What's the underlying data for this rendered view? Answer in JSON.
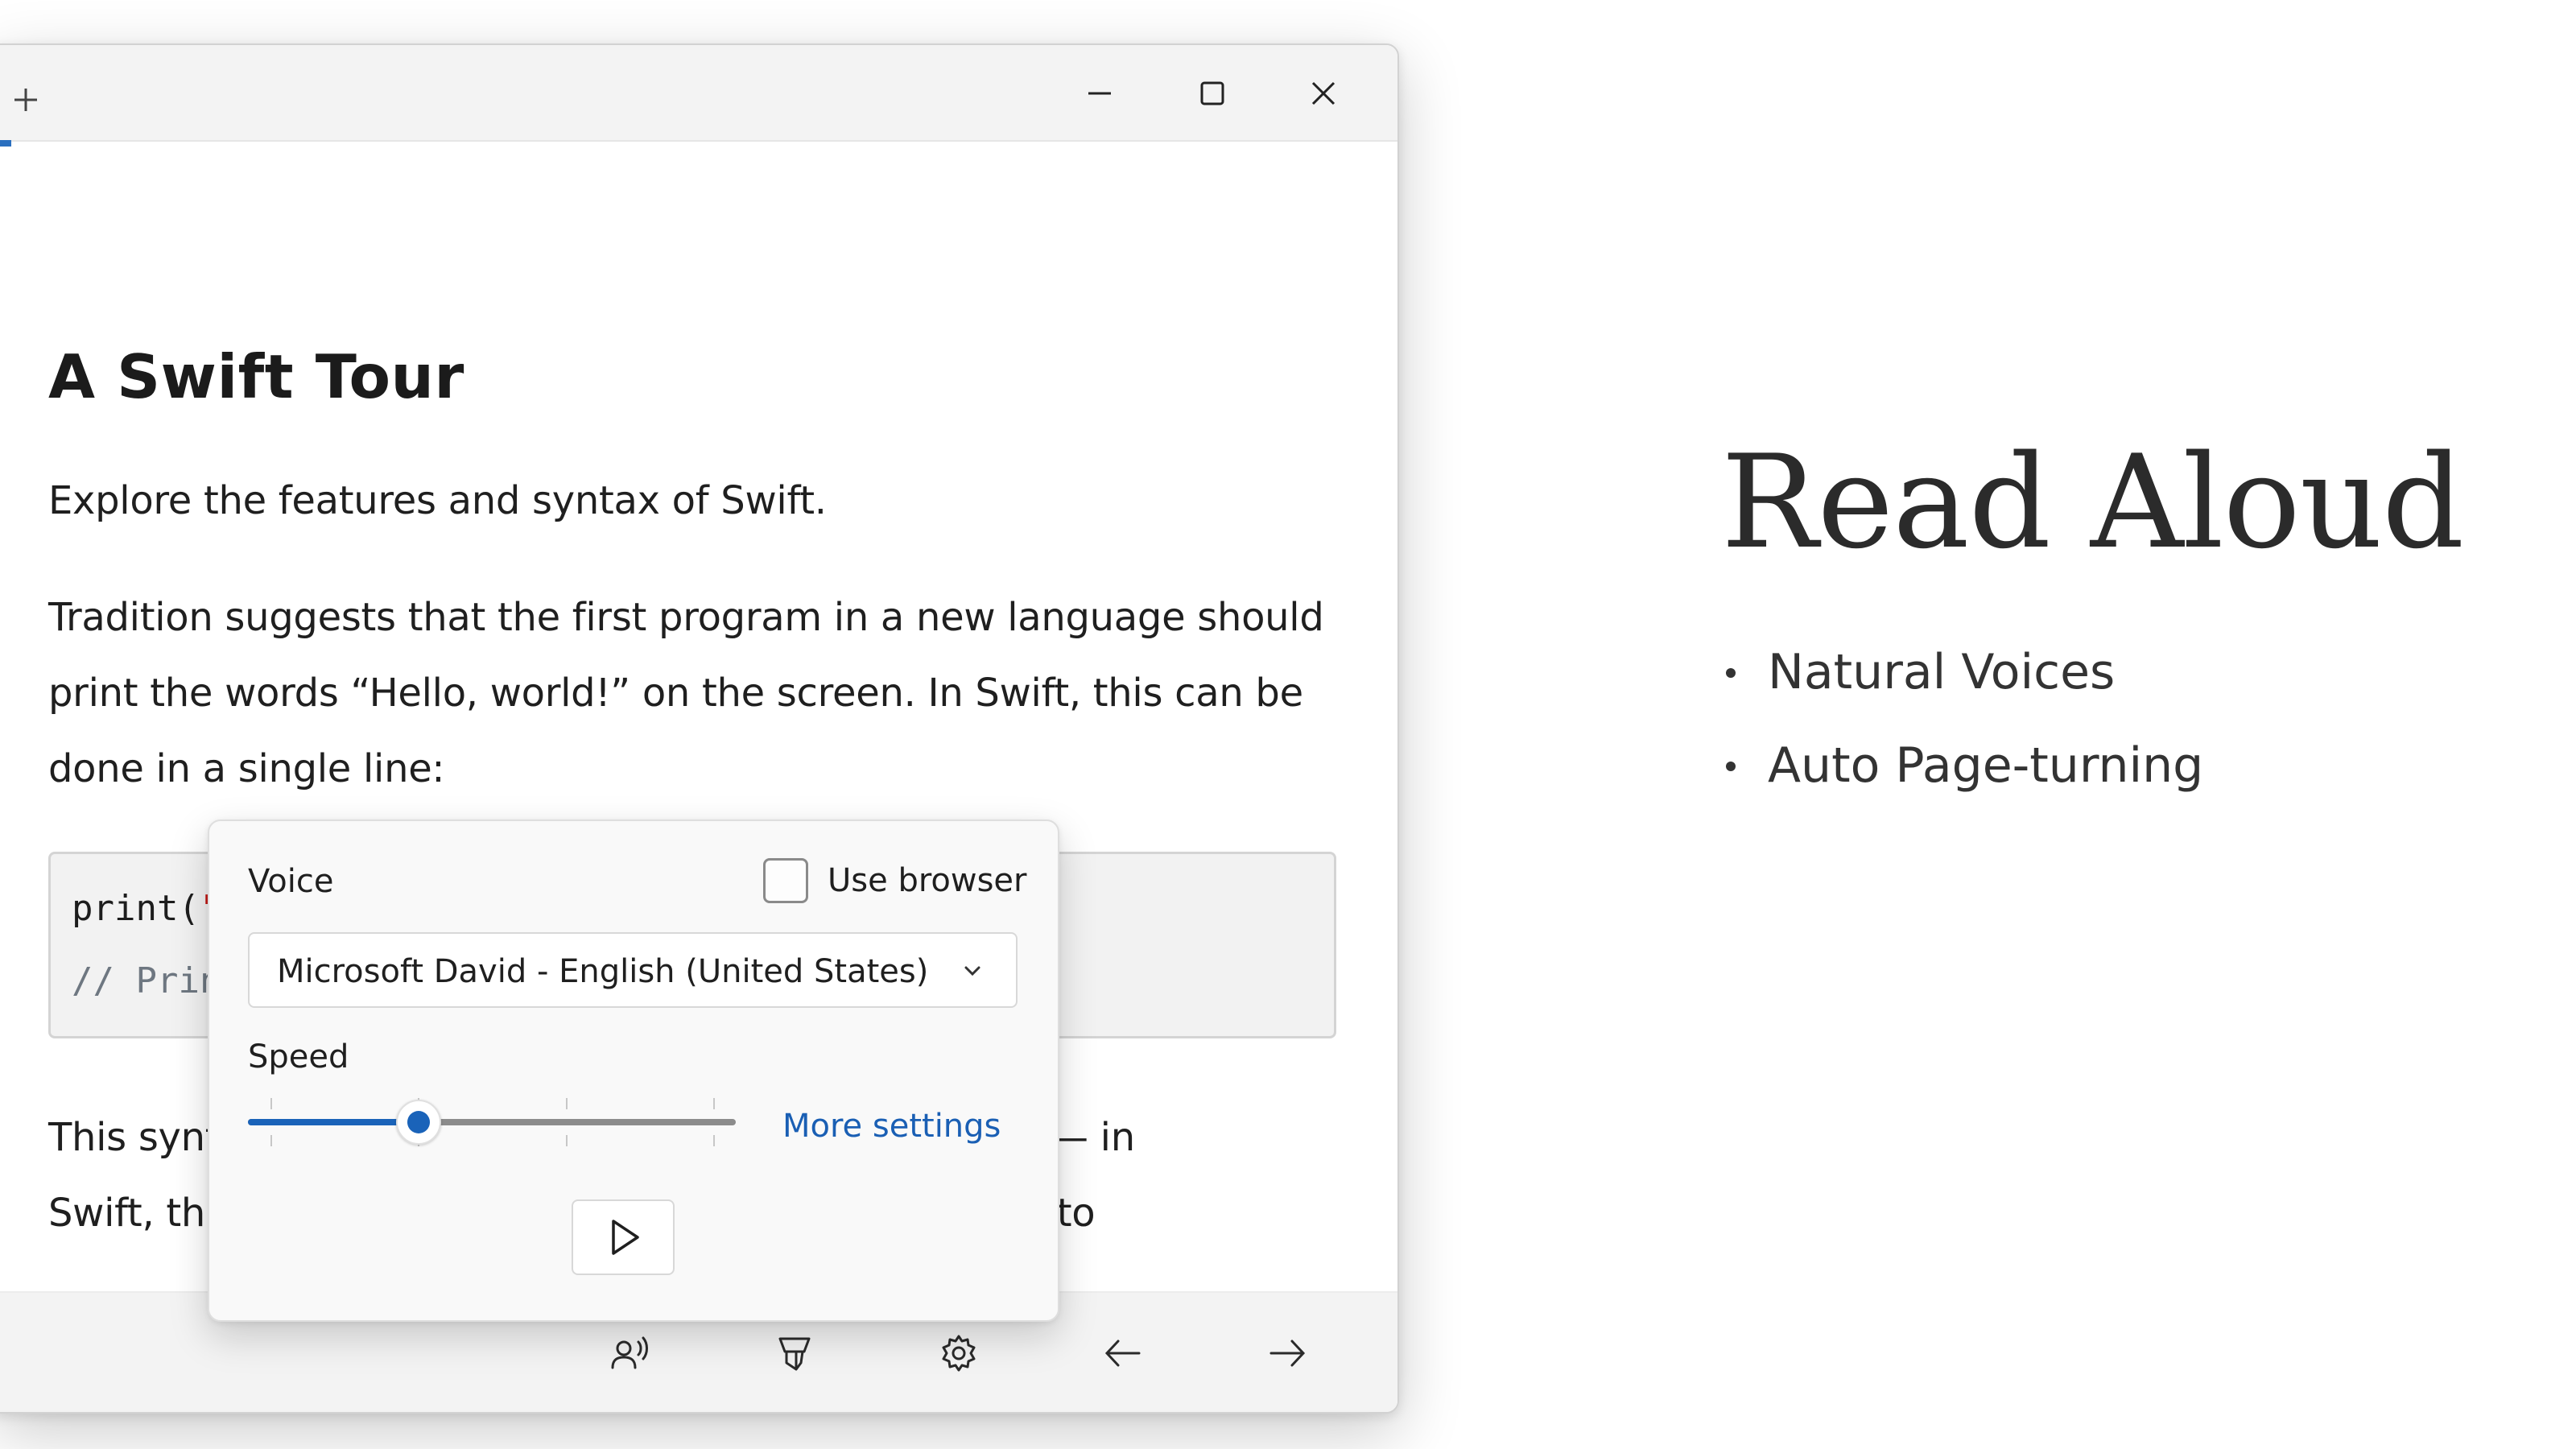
{
  "article": {
    "title": "A Swift Tour",
    "subtitle": "Explore the features and syntax of Swift.",
    "paragraph1_lines": [
      "Tradition suggests that the first program in a new language should",
      "print the words “Hello, world!” on the screen. In Swift, this can be",
      "done in a single line:"
    ],
    "code": {
      "line1_prefix": "print(",
      "line1_string": "\"",
      "line2": "// Prin"
    },
    "paragraph2_lines": [
      "This synt                                                      anguage — in",
      "Swift, this                                                      n’t need to"
    ]
  },
  "read_aloud_popup": {
    "voice_label": "Voice",
    "use_browser_label": "Use browser",
    "use_browser_checked": false,
    "voice_selected": "Microsoft David - English (United States)",
    "speed_label": "Speed",
    "speed_value_fraction": 0.35,
    "speed_ticks": 4,
    "more_settings_label": "More settings"
  },
  "icons": {
    "new_tab": "plus-icon",
    "minimize": "minimize-icon",
    "maximize": "maximize-icon",
    "close": "close-icon",
    "read_aloud": "read-aloud-icon",
    "highlight": "highlighter-icon",
    "settings": "gear-icon",
    "back": "arrow-left-icon",
    "forward": "arrow-right-icon",
    "play": "play-icon",
    "dropdown": "chevron-down-icon"
  },
  "colors": {
    "accent": "#1a63b9",
    "link": "#1a5fb4"
  },
  "promo": {
    "title": "Read Aloud",
    "features": [
      "Natural Voices",
      "Auto Page-turning"
    ]
  }
}
